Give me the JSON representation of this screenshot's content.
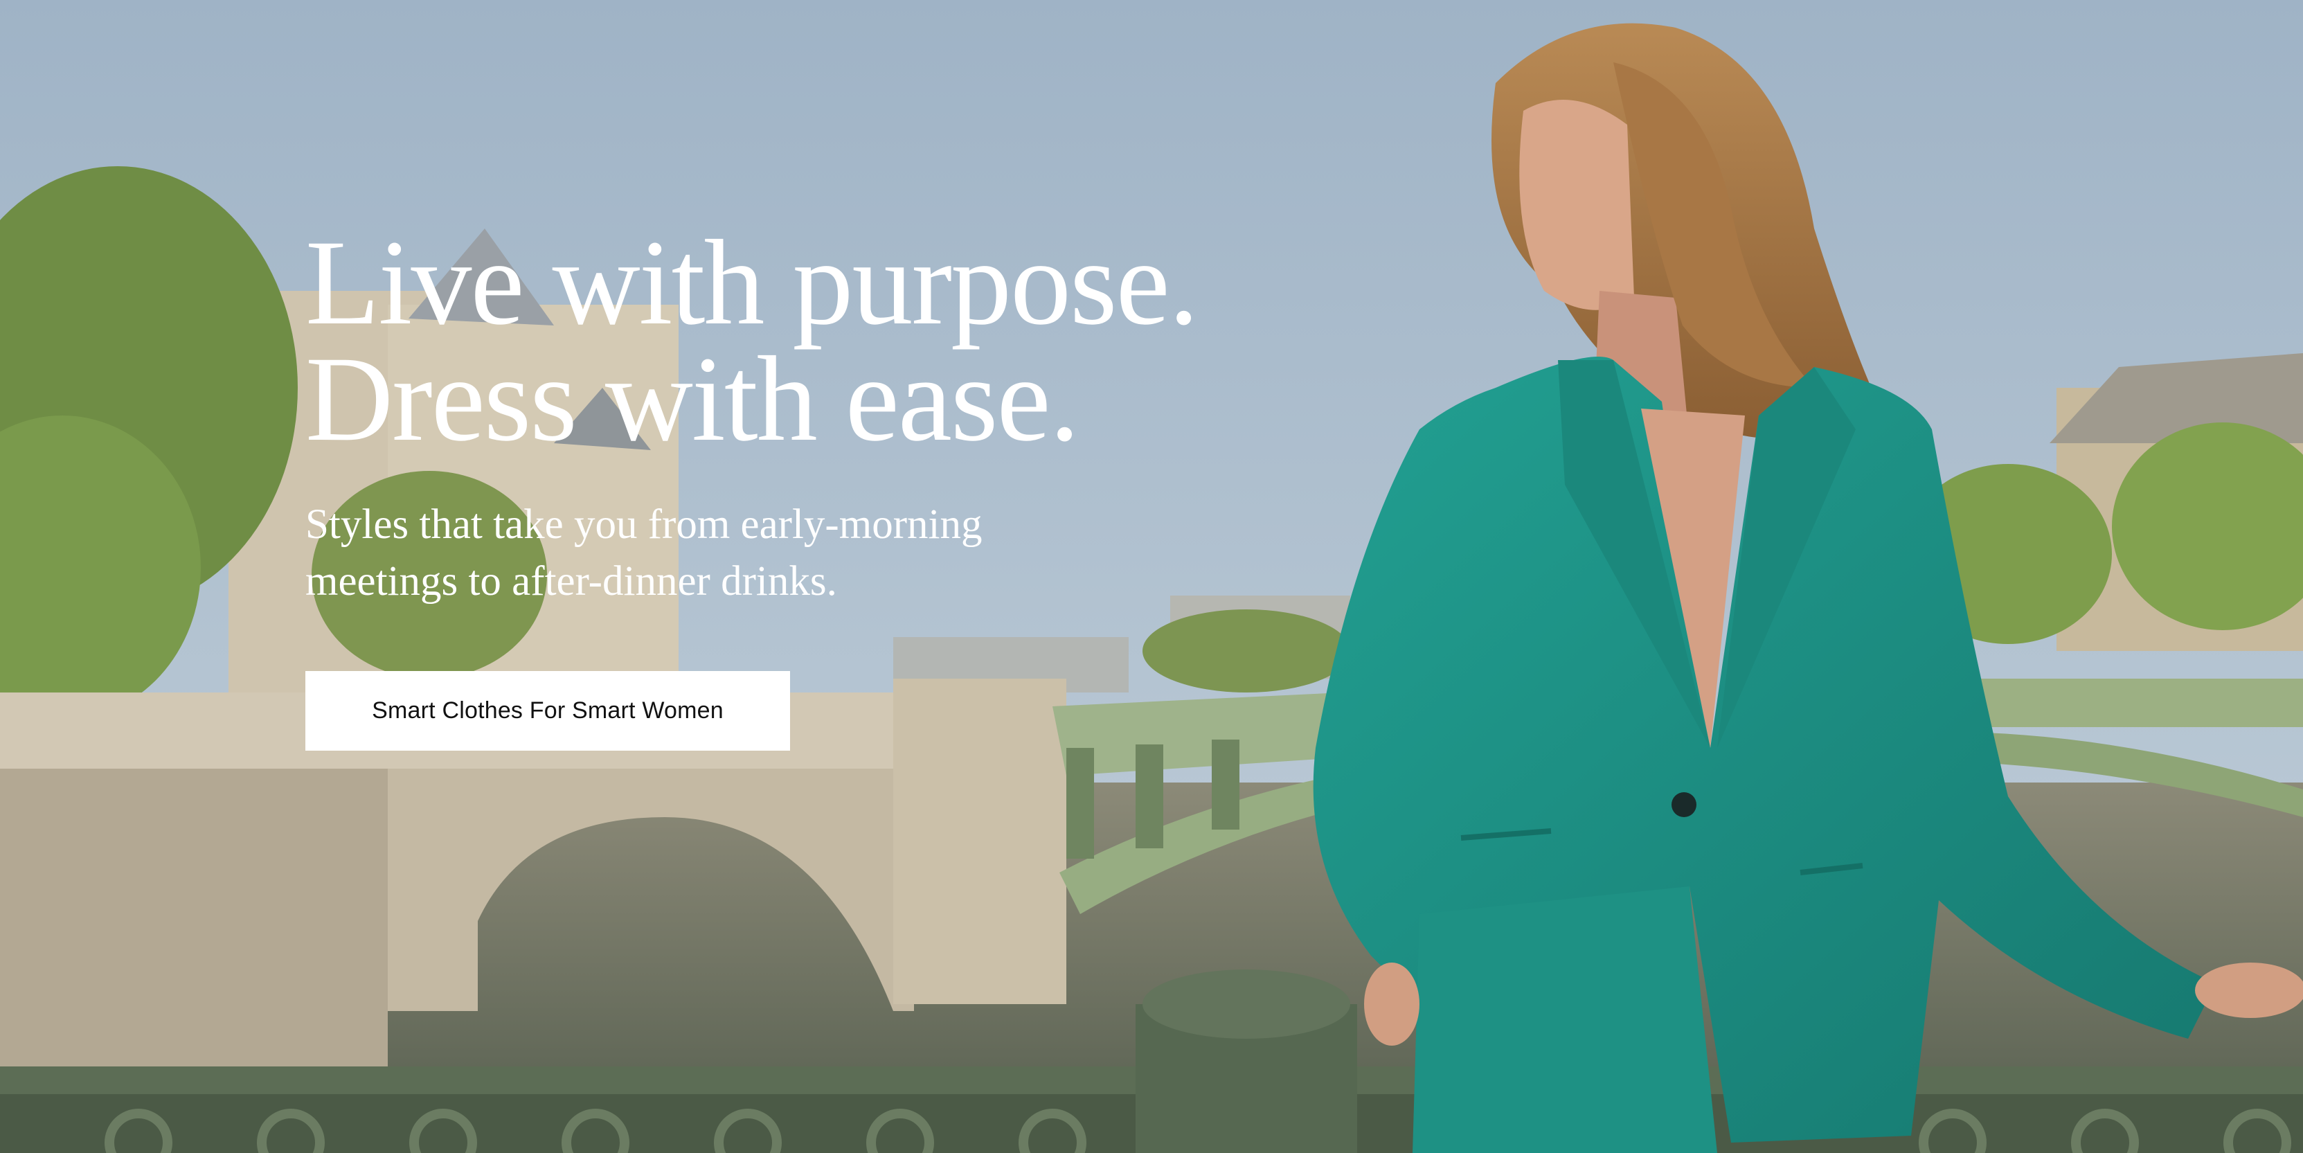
{
  "hero": {
    "headline_line1": "Live with purpose.",
    "headline_line2": "Dress with ease.",
    "subhead_line1": "Styles that take you from early-morning",
    "subhead_line2": "meetings to after-dinner drinks.",
    "cta_label": "Smart Clothes For Smart Women"
  },
  "colors": {
    "sky": "#a9bccd",
    "suit": "#1f9488",
    "bridge_stone": "#c9bfae",
    "iron_bridge": "#8fa57c",
    "railing": "#56664f",
    "cta_background": "#ffffff"
  }
}
